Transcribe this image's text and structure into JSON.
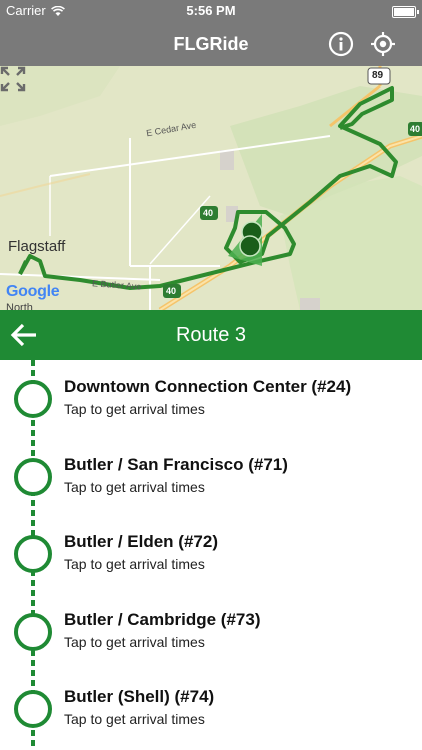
{
  "status_bar": {
    "carrier": "Carrier",
    "time": "5:56 PM"
  },
  "nav": {
    "title": "FLGRide",
    "info_icon": "info-icon",
    "locate_icon": "crosshair-icon"
  },
  "map": {
    "city_label": "Flagstaff",
    "road_labels": [
      "E Cedar Ave",
      "E Butler Ave",
      "North"
    ],
    "highway_shields": [
      "89",
      "40",
      "40",
      "40"
    ],
    "attribution": "Google",
    "route_color": "#2e8b2e"
  },
  "route": {
    "title": "Route 3",
    "back_icon": "arrow-left-icon",
    "color": "#1f8a34"
  },
  "stops": [
    {
      "name": "Downtown Connection Center (#24)",
      "subtitle": "Tap to get arrival times"
    },
    {
      "name": "Butler / San Francisco (#71)",
      "subtitle": "Tap to get arrival times"
    },
    {
      "name": "Butler / Elden (#72)",
      "subtitle": "Tap to get arrival times"
    },
    {
      "name": "Butler / Cambridge (#73)",
      "subtitle": "Tap to get arrival times"
    },
    {
      "name": "Butler (Shell) (#74)",
      "subtitle": "Tap to get arrival times"
    }
  ]
}
